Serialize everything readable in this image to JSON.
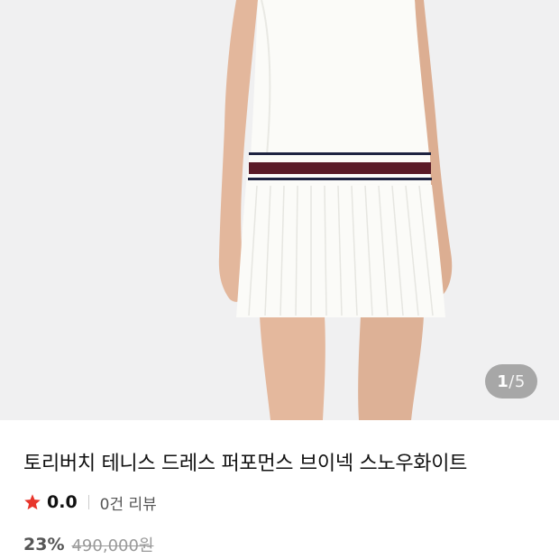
{
  "gallery": {
    "current_page": "1",
    "separator": "/",
    "total_pages": "5",
    "colors": {
      "background": "#f0f0f1",
      "dress": "#fbfbf8",
      "stripe_navy": "#1e2340",
      "stripe_burgundy": "#5a1b27"
    }
  },
  "product": {
    "title": "토리버치 테니스 드레스 퍼포먼스 브이넥 스노우화이트",
    "rating": {
      "icon": "star-icon",
      "value": "0.0",
      "review_count": "0건 리뷰",
      "star_color": "#e8352b"
    },
    "price": {
      "discount": "23%",
      "original": "490,000원"
    }
  }
}
